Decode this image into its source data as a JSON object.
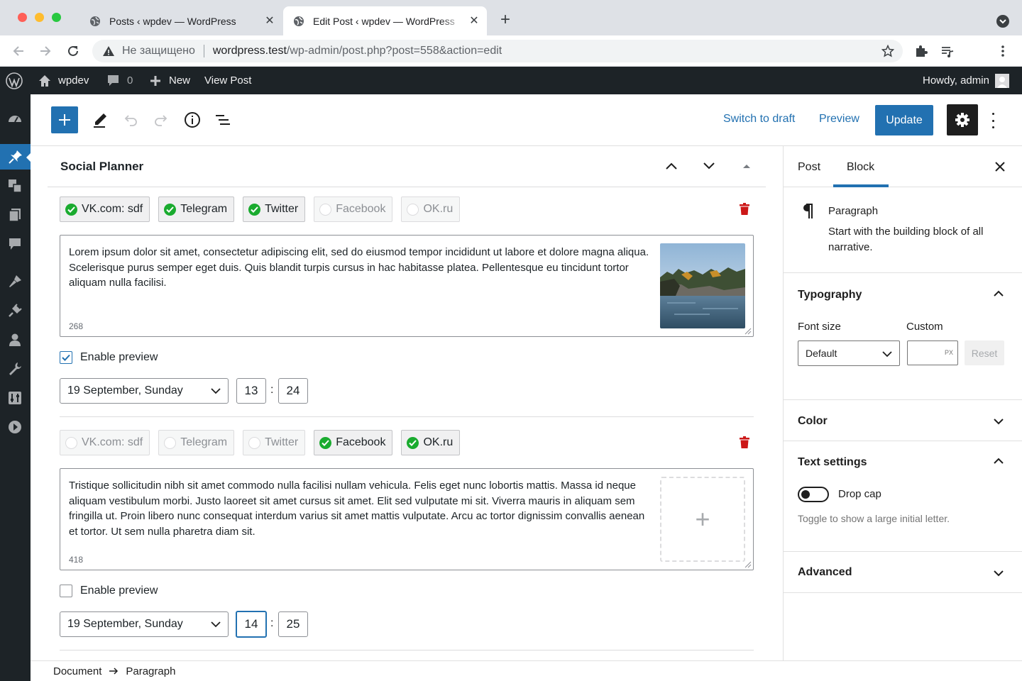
{
  "browser": {
    "tabs": [
      {
        "title": "Posts ‹ wpdev — WordPress",
        "close": "✕"
      },
      {
        "title": "Edit Post ‹ wpdev — WordPress",
        "close": "✕"
      }
    ],
    "new_tab": "+",
    "security_label": "Не защищено",
    "url_host": "wordpress.test",
    "url_path": "/wp-admin/post.php?post=558&action=edit"
  },
  "adminbar": {
    "site_name": "wpdev",
    "comments_count": "0",
    "new_label": "New",
    "view_post": "View Post",
    "howdy": "Howdy, admin"
  },
  "header": {
    "switch_to_draft": "Switch to draft",
    "preview": "Preview",
    "update": "Update"
  },
  "panel": {
    "title": "Social Planner"
  },
  "tasks": [
    {
      "networks": [
        {
          "label": "VK.com: sdf",
          "enabled": true
        },
        {
          "label": "Telegram",
          "enabled": true
        },
        {
          "label": "Twitter",
          "enabled": true
        },
        {
          "label": "Facebook",
          "enabled": false
        },
        {
          "label": "OK.ru",
          "enabled": false
        }
      ],
      "message": "Lorem ipsum dolor sit amet, consectetur adipiscing elit, sed do eiusmod tempor incididunt ut labore et dolore magna aliqua. Scelerisque purus semper eget duis. Quis blandit turpis cursus in hac habitasse platea. Pellentesque eu tincidunt tortor aliquam nulla facilisi.",
      "char_count": "268",
      "has_image": true,
      "enable_preview_label": "Enable preview",
      "enable_preview": true,
      "date": "19 September, Sunday",
      "hour": "13",
      "minute": "24"
    },
    {
      "networks": [
        {
          "label": "VK.com: sdf",
          "enabled": false
        },
        {
          "label": "Telegram",
          "enabled": false
        },
        {
          "label": "Twitter",
          "enabled": false
        },
        {
          "label": "Facebook",
          "enabled": true
        },
        {
          "label": "OK.ru",
          "enabled": true
        }
      ],
      "message": "Tristique sollicitudin nibh sit amet commodo nulla facilisi nullam vehicula. Felis eget nunc lobortis mattis. Massa id neque aliquam vestibulum morbi. Justo laoreet sit amet cursus sit amet. Elit sed vulputate mi sit. Viverra mauris in aliquam sem fringilla ut. Proin libero nunc consequat interdum varius sit amet mattis vulputate. Arcu ac tortor dignissim convallis aenean et tortor. Ut sem nulla pharetra diam sit.",
      "char_count": "418",
      "has_image": false,
      "add_image": "+",
      "enable_preview_label": "Enable preview",
      "enable_preview": false,
      "date": "19 September, Sunday",
      "hour": "14",
      "minute": "25"
    }
  ],
  "time_separator": ":",
  "breadcrumb": {
    "root": "Document",
    "current": "Paragraph"
  },
  "sidebar": {
    "tabs": [
      "Post",
      "Block"
    ],
    "active_tab": "Block",
    "block_name": "Paragraph",
    "block_description": "Start with the building block of all narrative.",
    "typography": {
      "title": "Typography",
      "font_size_label": "Font size",
      "custom_label": "Custom",
      "font_size_value": "Default",
      "custom_unit": "PX",
      "reset": "Reset"
    },
    "color": "Color",
    "text_settings": {
      "title": "Text settings",
      "drop_cap": "Drop cap",
      "drop_cap_help": "Toggle to show a large initial letter.",
      "drop_cap_enabled": false
    },
    "advanced": "Advanced"
  },
  "colors": {
    "wp_blue": "#2271b1",
    "admin_dark": "#1d2327",
    "check_green": "#1aab2f",
    "trash_red": "#cc1818"
  }
}
